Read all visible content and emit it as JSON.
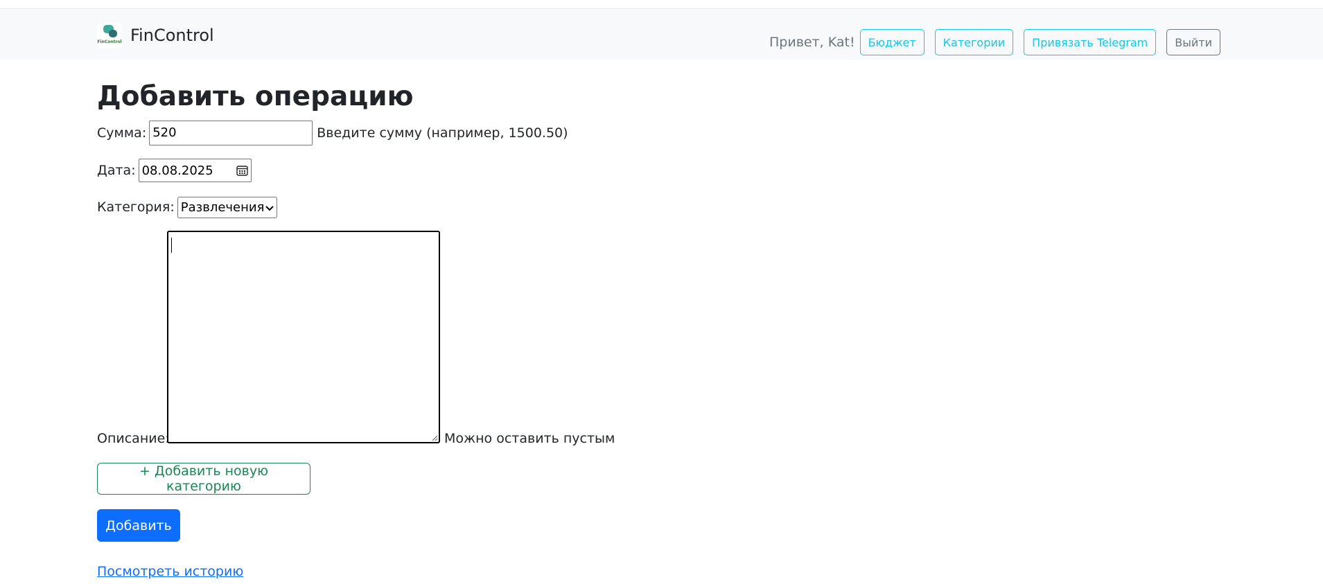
{
  "navbar": {
    "brand_name": "FinControl",
    "logo_text": "FinControl",
    "greeting": "Привет, Kat!",
    "buttons": {
      "budget": "Бюджет",
      "categories": "Категории",
      "telegram": "Привязать Telegram",
      "logout": "Выйти"
    }
  },
  "page": {
    "title": "Добавить операцию"
  },
  "form": {
    "amount": {
      "label": "Сумма:",
      "value": "520",
      "hint": "Введите сумму (например, 1500.50)"
    },
    "date": {
      "label": "Дата:",
      "value": "08.08.2025"
    },
    "category": {
      "label": "Категория:",
      "selected": "Развлечения"
    },
    "description": {
      "label": "Описание:",
      "value": "",
      "hint": "Можно оставить пустым"
    },
    "add_category_button": "+ Добавить новую категорию",
    "submit_button": "Добавить"
  },
  "links": {
    "history": "Посмотреть историю"
  },
  "colors": {
    "primary": "#0d6efd",
    "info": "#0dcaf0",
    "success": "#198754",
    "secondary": "#6c757d",
    "navbar_bg": "#f8f9fa"
  }
}
